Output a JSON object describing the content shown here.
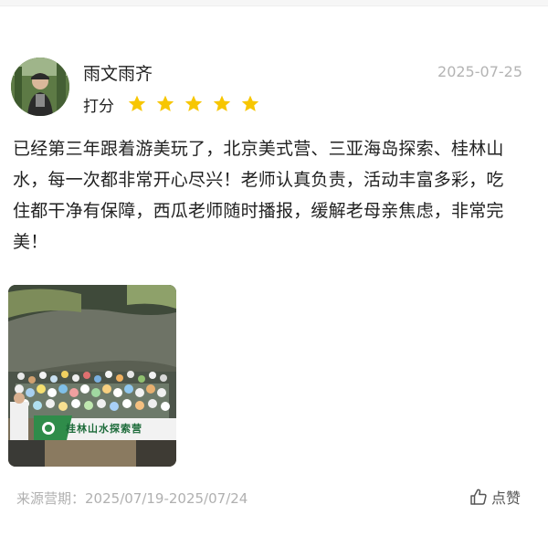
{
  "review": {
    "username": "雨文雨齐",
    "date": "2025-07-25",
    "rating_label": "打分",
    "rating": 5,
    "rating_max": 5,
    "text": "已经第三年跟着游美玩了，北京美式营、三亚海岛探索、桂林山水，每一次都非常开心尽兴！老师认真负责，活动丰富多彩，吃住都干净有保障，西瓜老师随时播报，缓解老母亲焦虑，非常完美！",
    "photo_banner_text": "桂林山水探索营"
  },
  "footer": {
    "source_label": "来源营期：",
    "source_period": "2025/07/19-2025/07/24",
    "like_label": "点赞"
  },
  "colors": {
    "star": "#f7c600",
    "date_gray": "#b4b4b4",
    "text": "#222222"
  },
  "icons": {
    "star": "star-icon",
    "like": "thumbs-up-icon"
  }
}
